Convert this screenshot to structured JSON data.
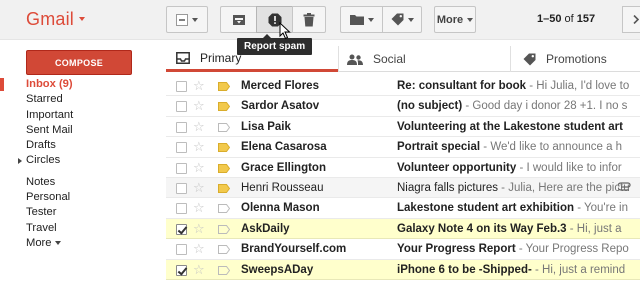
{
  "brand": {
    "name": "Gmail"
  },
  "toolbar": {
    "more_label": "More",
    "tooltip": "Report spam",
    "page_start": "1–50",
    "page_of": "of",
    "page_total": "157"
  },
  "compose_label": "COMPOSE",
  "nav": {
    "items": [
      {
        "label": "Inbox (9)"
      },
      {
        "label": "Starred"
      },
      {
        "label": "Important"
      },
      {
        "label": "Sent Mail"
      },
      {
        "label": "Drafts"
      },
      {
        "label": "Circles"
      },
      {
        "label": "Notes"
      },
      {
        "label": "Personal"
      },
      {
        "label": "Tester"
      },
      {
        "label": "Travel"
      },
      {
        "label": "More"
      }
    ]
  },
  "tabs": [
    {
      "label": "Primary"
    },
    {
      "label": "Social"
    },
    {
      "label": "Promotions"
    }
  ],
  "emails": [
    {
      "sender": "Merced Flores",
      "subject": "Re: consultant for book",
      "snippet": " - Hi Julia, I'd love to",
      "unread": true,
      "checked": false,
      "important": true
    },
    {
      "sender": "Sardor Asatov",
      "subject": "(no subject)",
      "snippet": " - Good day i donor 28 +1. I no s",
      "unread": true,
      "checked": false,
      "important": true
    },
    {
      "sender": "Lisa Paik",
      "subject": "Volunteering at the Lakestone student art",
      "snippet": "",
      "unread": true,
      "checked": false,
      "important": false
    },
    {
      "sender": "Elena Casarosa",
      "subject": "Portrait special",
      "snippet": " - We'd like to announce a h",
      "unread": true,
      "checked": false,
      "important": true
    },
    {
      "sender": "Grace Ellington",
      "subject": "Volunteer opportunity",
      "snippet": " - I would like to infor",
      "unread": true,
      "checked": false,
      "important": true
    },
    {
      "sender": "Henri Rousseau",
      "subject": "Niagra falls pictures",
      "snippet": " - Julia, Here are the pictu",
      "unread": false,
      "checked": false,
      "important": true,
      "attachment": true
    },
    {
      "sender": "Olenna Mason",
      "subject": "Lakestone student art exhibition",
      "snippet": " - You're in",
      "unread": true,
      "checked": false,
      "important": false
    },
    {
      "sender": "AskDaily",
      "subject": "Galaxy Note 4 on its Way Feb.3",
      "snippet": " - Hi, just a",
      "unread": true,
      "checked": true,
      "important": false
    },
    {
      "sender": "BrandYourself.com",
      "subject": "Your Progress Report",
      "snippet": " - Your Progress Repo",
      "unread": true,
      "checked": false,
      "important": false
    },
    {
      "sender": "SweepsADay",
      "subject": "iPhone 6 to be -Shipped-",
      "snippet": " - Hi, just a remind",
      "unread": true,
      "checked": true,
      "important": false
    }
  ],
  "colors": {
    "accent": "#dd4b39",
    "compose_bg": "#d14836",
    "important_tag": "#f2c94c",
    "selected_row": "#ffffcc"
  },
  "icons": {
    "select": "checkbox-dropdown-icon",
    "archive": "archive-icon",
    "spam": "report-spam-icon",
    "delete": "trash-icon",
    "move": "folder-icon",
    "labels": "label-icon",
    "older": "chevron-right-icon",
    "primary_tab": "inbox-icon",
    "social_tab": "people-icon",
    "promotions_tab": "tag-icon",
    "important": "important-marker-icon",
    "star": "star-icon",
    "attachment": "paperclip-icon"
  }
}
